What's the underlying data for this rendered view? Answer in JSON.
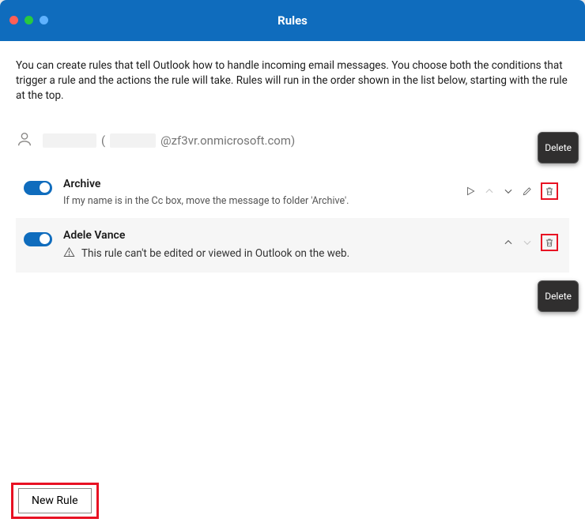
{
  "window": {
    "title": "Rules",
    "description": "You can create rules that tell Outlook how to handle incoming email messages. You choose both the conditions that trigger a rule and the actions the rule will take. Rules will run in the order shown in the list below, starting with the rule at the top."
  },
  "account": {
    "email_suffix": "@zf3vr.onmicrosoft.com)"
  },
  "tooltips": {
    "delete": "Delete"
  },
  "rules": [
    {
      "title": "Archive",
      "description": "If my name is in the Cc box, move the message to folder 'Archive'."
    },
    {
      "title": "Adele Vance",
      "warning": "This rule can't be edited or viewed in Outlook on the web."
    }
  ],
  "buttons": {
    "new_rule": "New Rule"
  }
}
